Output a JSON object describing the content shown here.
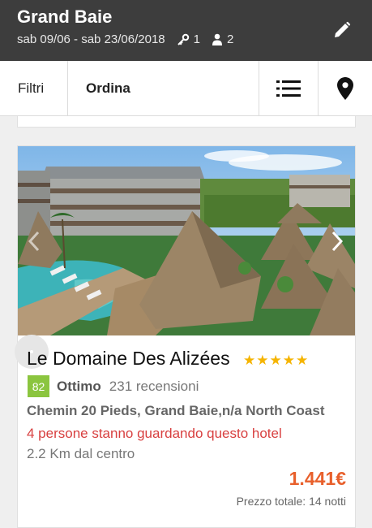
{
  "header": {
    "title": "Grand Baie",
    "dates": "sab 09/06 - sab 23/06/2018",
    "rooms_count": "1",
    "guests_count": "2",
    "icons": {
      "rooms": "key-icon",
      "guests": "person-icon",
      "edit": "pencil-icon"
    }
  },
  "toolbar": {
    "filters_label": "Filtri",
    "sort_label": "Ordina",
    "icons": {
      "list": "list-view-icon",
      "map": "map-pin-icon"
    }
  },
  "hotel": {
    "name": "Le Domaine Des Alizées",
    "stars": "★★★★★",
    "star_count": 5,
    "score": "82",
    "rating_label": "Ottimo",
    "reviews": "231 recensioni",
    "address": "Chemin 20 Pieds, Grand Baie,n/a North Coast",
    "watching": "4 persone stanno guardando questo hotel",
    "distance": "2.2 Km dal centro",
    "price": "1.441€",
    "price_note": "Prezzo totale: 14 notti"
  },
  "colors": {
    "header_bg": "#3d3d3d",
    "score_bg": "#8bc53f",
    "stars": "#f5b400",
    "price": "#e8602c",
    "alert_text": "#d84040"
  }
}
